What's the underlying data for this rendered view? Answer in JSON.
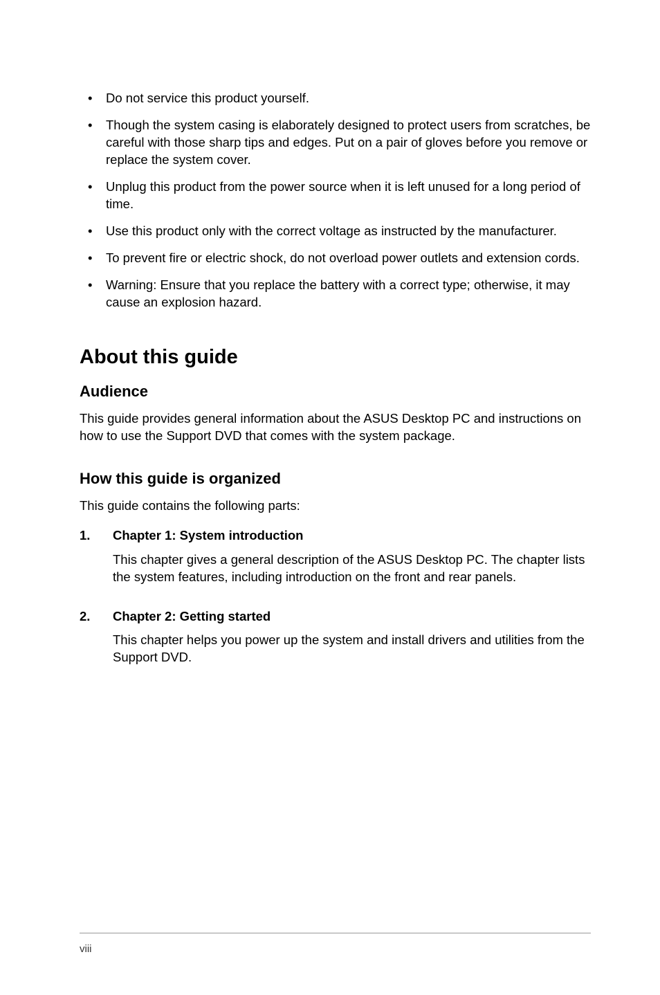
{
  "bullets": [
    "Do not service this product yourself.",
    "Though the system casing is elaborately designed to protect users from scratches, be careful with those sharp tips and edges. Put on a pair of gloves before you remove or replace the system cover.",
    "Unplug this product from the power source when it is left unused for a long period of time.",
    "Use this product only with the correct voltage as instructed by the manufacturer.",
    "To prevent fire or electric shock, do not overload power outlets and extension cords.",
    "Warning: Ensure that you replace the battery with a correct type; otherwise, it may cause an explosion hazard."
  ],
  "section_title": "About this guide",
  "audience": {
    "heading": "Audience",
    "body": "This guide provides general information about the ASUS Desktop PC and instructions on how to use the Support DVD that comes with the system package."
  },
  "organized": {
    "heading": "How this guide is organized",
    "intro": "This guide contains the following parts:",
    "items": [
      {
        "num": "1.",
        "title": "Chapter 1: System introduction",
        "desc": "This chapter gives a general description of the ASUS Desktop PC. The chapter lists the system features, including introduction on the front and rear panels."
      },
      {
        "num": "2.",
        "title": "Chapter 2: Getting started",
        "desc": "This chapter helps you power up the system and install drivers and utilities from the Support DVD."
      }
    ]
  },
  "page_number": "viii"
}
